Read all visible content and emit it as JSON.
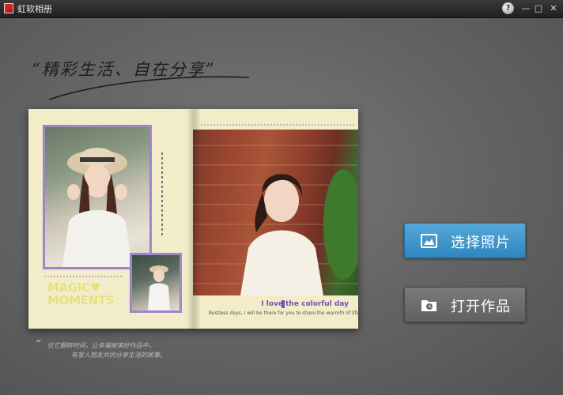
{
  "window": {
    "title": "虹软相册",
    "help_icon": "help-icon",
    "minimize_glyph": "—",
    "maximize_glyph": "□",
    "close_glyph": "✕"
  },
  "slogan": "“精彩生活、自在分享”",
  "album": {
    "magic_line1": "MAGIC",
    "heart": "♥",
    "magic_line2": "MOMENTS",
    "love_title": "I love the colorful day",
    "love_sub": "Restless days, I will be there for you to share the warmth of life."
  },
  "buttons": {
    "select_photos": "选择照片",
    "open_works": "打开作品"
  },
  "handwriting": {
    "quote": "“",
    "line1": "任它翻转时间，让幸福被美好作品中，",
    "line2": "有家人朋友共同分享生活的故事。"
  },
  "colors": {
    "select_button": "#3a93cc",
    "open_button": "#6e6e6e",
    "frame_purple": "#9d86c9",
    "page_cream": "#f2ecc9"
  }
}
